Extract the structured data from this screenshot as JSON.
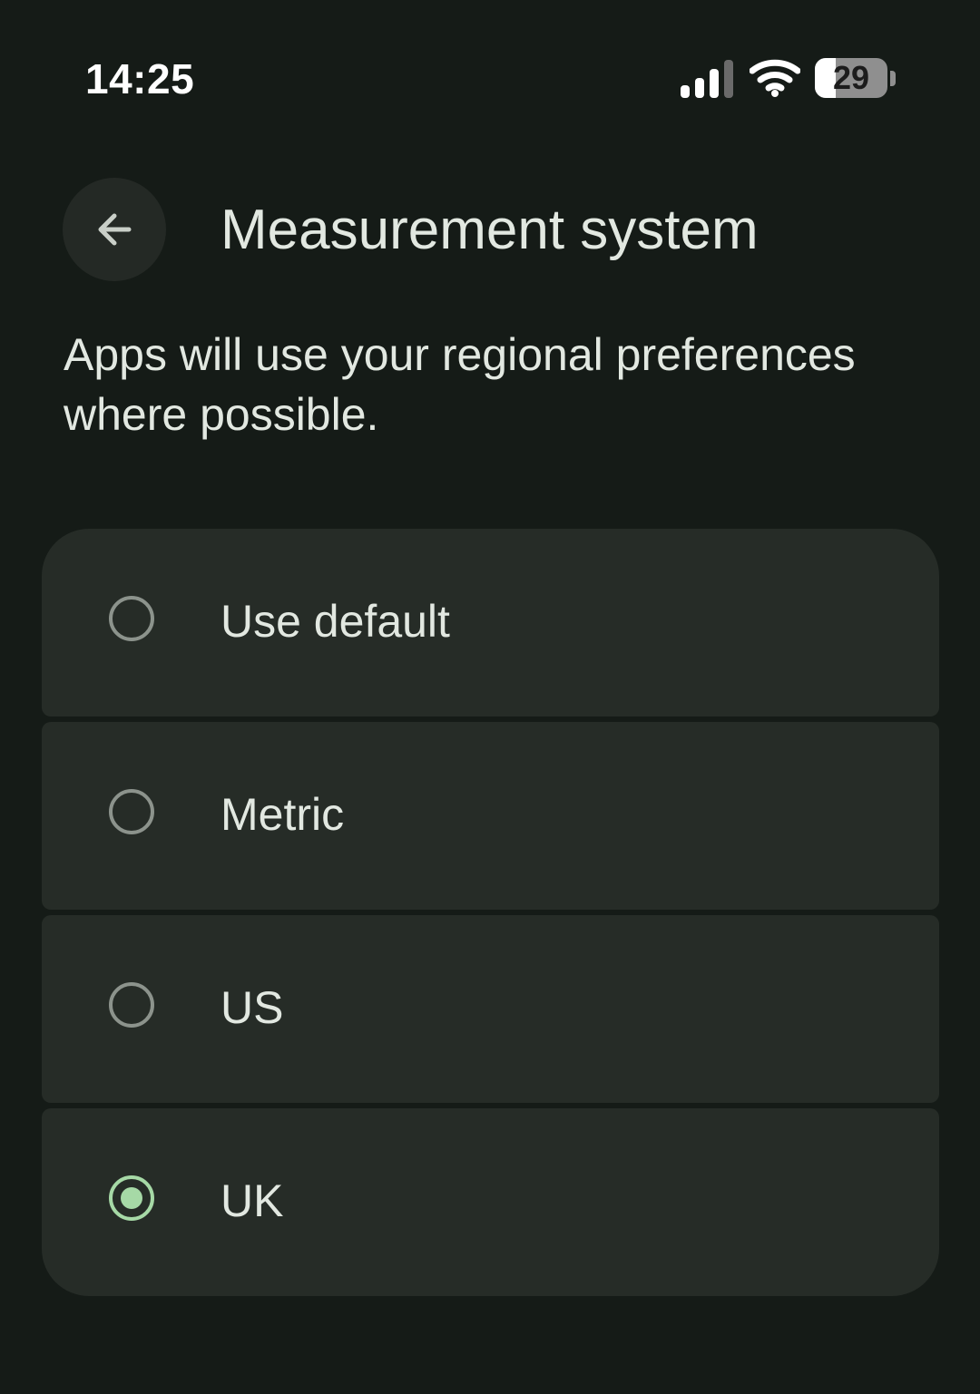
{
  "status_bar": {
    "time": "14:25",
    "battery_level": "29",
    "icons": [
      "signal-icon",
      "wifi-icon",
      "battery-icon"
    ]
  },
  "header": {
    "back_icon": "arrow-back-icon",
    "title": "Measurement system"
  },
  "description": "Apps will use your regional preferences where possible.",
  "options": [
    {
      "label": "Use default",
      "selected": false
    },
    {
      "label": "Metric",
      "selected": false
    },
    {
      "label": "US",
      "selected": false
    },
    {
      "label": "UK",
      "selected": true
    }
  ],
  "colors": {
    "background": "#151b17",
    "card": "#262c27",
    "accent": "#a6d9a6",
    "text": "#e2e8e1"
  }
}
